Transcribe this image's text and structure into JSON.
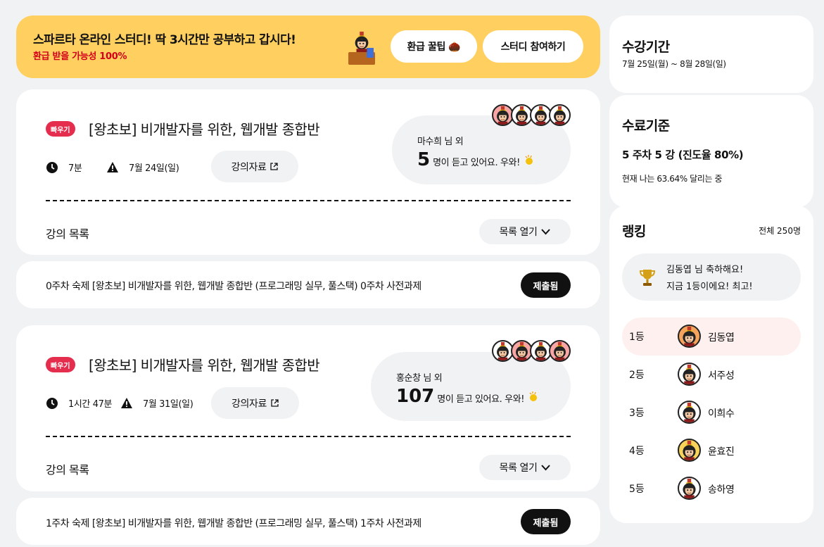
{
  "banner": {
    "title": "스파르타 온라인 스터디! 딱 3시간만 공부하고 갑시다!",
    "subtitle": "환급 받을 가능성 100%",
    "refund_tip_label": "환급 꿀팁 🌰",
    "join_study_label": "스터디 참여하기"
  },
  "courses": [
    {
      "tag": "빠우기",
      "title": "[왕초보] 비개발자를 위한, 웹개발 종합반",
      "duration": "7분",
      "date": "7월 24일(일)",
      "materials_label": "강의자료",
      "listener_name": "마수희 님 외",
      "listener_count": "5",
      "listener_text": "명이 듣고 있어요. 우와!",
      "list_label": "강의 목록",
      "open_list_label": "목록 열기",
      "homework_text": "0주차 숙제 [왕초보] 비개발자를 위한, 웹개발 종합반 (프로그래밍 실무, 풀스택) 0주차 사전과제",
      "homework_status": "제출됨"
    },
    {
      "tag": "빠우기",
      "title": "[왕초보] 비개발자를 위한, 웹개발 종합반",
      "duration": "1시간 47분",
      "date": "7월 31일(일)",
      "materials_label": "강의자료",
      "listener_name": "홍순창 님 외",
      "listener_count": "107",
      "listener_text": "명이 듣고 있어요. 우와!",
      "list_label": "강의 목록",
      "open_list_label": "목록 열기",
      "homework_text": "1주차 숙제 [왕초보] 비개발자를 위한, 웹개발 종합반 (프로그래밍 실무, 풀스택) 1주차 사전과제",
      "homework_status": "제출됨"
    }
  ],
  "period": {
    "title": "수강기간",
    "dates": "7월 25일(월) ~ 8월 28일(일)"
  },
  "completion": {
    "title": "수료기준",
    "criteria": "5 주차 5 강 (진도율 80%)",
    "current": "현재 나는 63.64% 달리는 중"
  },
  "ranking": {
    "title": "랭킹",
    "total": "전체 250명",
    "congrats_line1": "김동엽 님 축하해요!",
    "congrats_line2": "지금 1등이에요! 최고!",
    "rows": [
      {
        "rank": "1등",
        "name": "김동엽"
      },
      {
        "rank": "2등",
        "name": "서주성"
      },
      {
        "rank": "3등",
        "name": "이희수"
      },
      {
        "rank": "4등",
        "name": "윤효진"
      },
      {
        "rank": "5등",
        "name": "송하영"
      }
    ]
  },
  "colors": {
    "banner_bg": "#ffd060",
    "tag_red": "#e52e4d",
    "rank_highlight": "#fff0f0",
    "page_bg": "#f1f2f4"
  }
}
